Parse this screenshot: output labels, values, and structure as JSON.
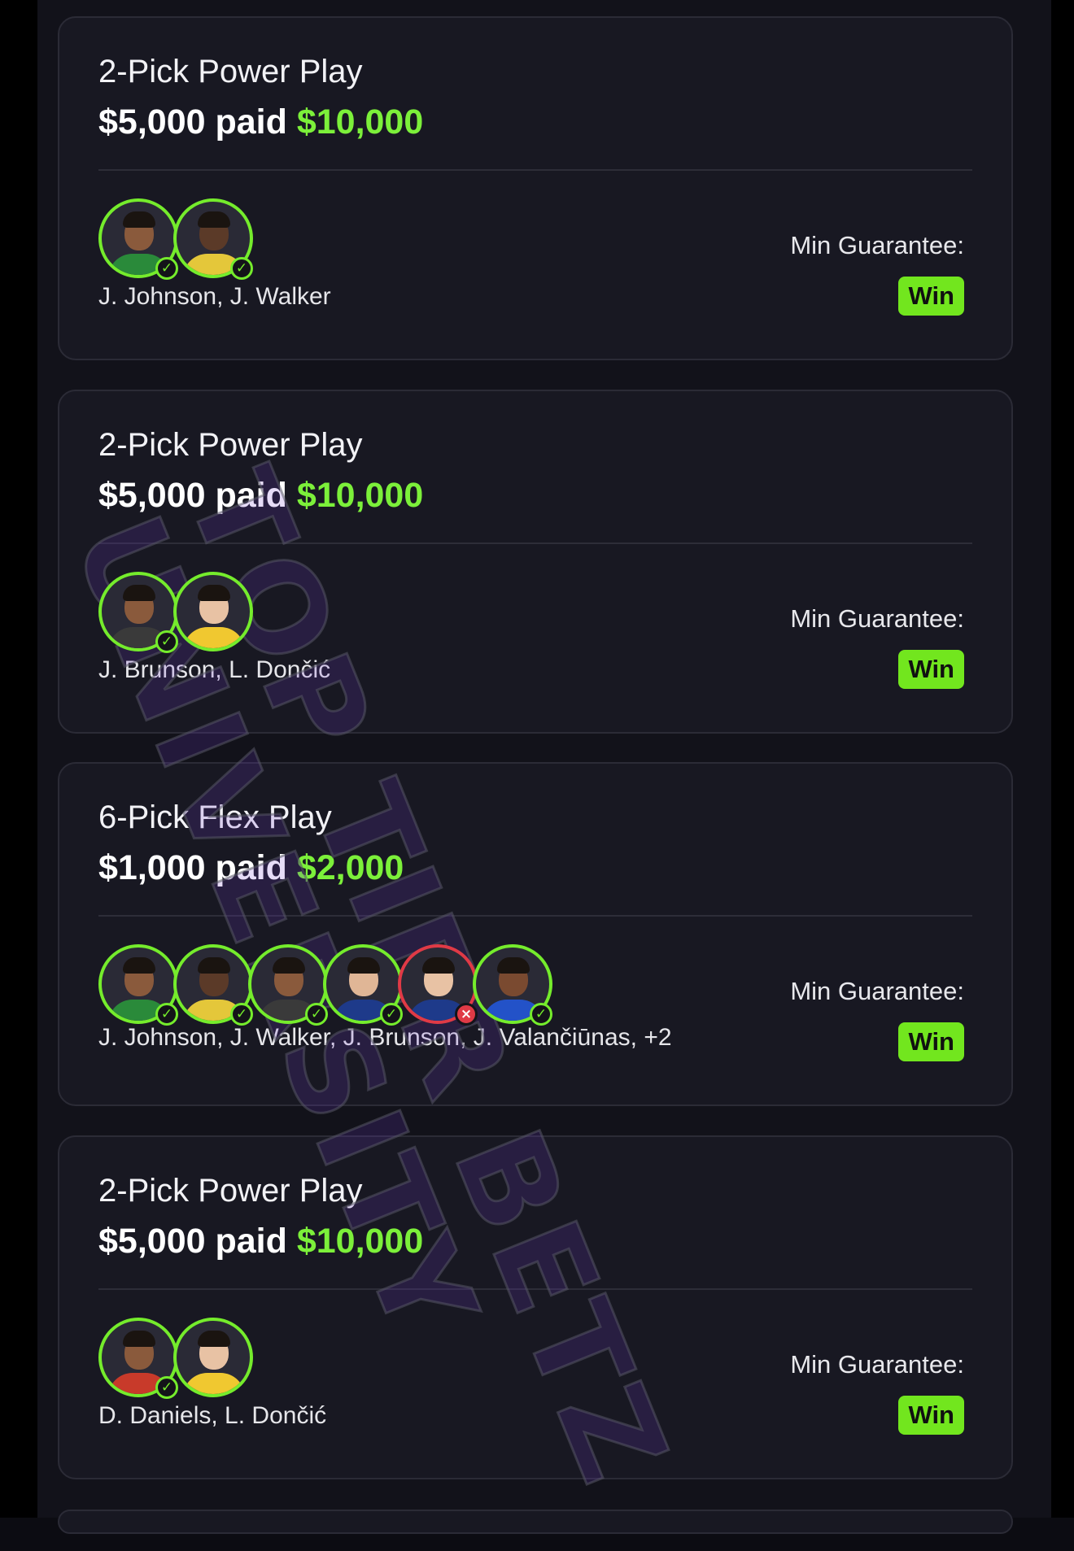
{
  "cards": [
    {
      "title": "2-Pick Power Play",
      "paid_text": "$5,000 paid",
      "won_text": "$10,000",
      "players_text": "J. Johnson, J. Walker",
      "guarantee_label": "Min Guarantee:",
      "result_label": "Win",
      "picks": [
        {
          "status": "won",
          "skin": "#8a5a3c",
          "shirt": "#2a8a3a"
        },
        {
          "status": "won",
          "skin": "#5b3a28",
          "shirt": "#e4c73a"
        }
      ]
    },
    {
      "title": "2-Pick Power Play",
      "paid_text": "$5,000 paid",
      "won_text": "$10,000",
      "players_text": "J. Brunson, L. Dončić",
      "guarantee_label": "Min Guarantee:",
      "result_label": "Win",
      "picks": [
        {
          "status": "won",
          "skin": "#8a5a3c",
          "shirt": "#3a3a3a"
        },
        {
          "status": "none",
          "skin": "#e8c2a4",
          "shirt": "#f0c830"
        }
      ]
    },
    {
      "title": "6-Pick Flex Play",
      "paid_text": "$1,000 paid",
      "won_text": "$2,000",
      "players_text": "J. Johnson, J. Walker, J. Brunson, J. Valančiūnas, +2",
      "guarantee_label": "Min Guarantee:",
      "result_label": "Win",
      "picks": [
        {
          "status": "won",
          "skin": "#8a5a3c",
          "shirt": "#2a8a3a"
        },
        {
          "status": "won",
          "skin": "#5b3a28",
          "shirt": "#e4c73a"
        },
        {
          "status": "won",
          "skin": "#8a5a3c",
          "shirt": "#3a3a3a"
        },
        {
          "status": "won",
          "skin": "#e0b696",
          "shirt": "#1e3a8a"
        },
        {
          "status": "lost",
          "skin": "#e8c2a4",
          "shirt": "#1e3a8a"
        },
        {
          "status": "won",
          "skin": "#7a4a30",
          "shirt": "#2352c8"
        }
      ]
    },
    {
      "title": "2-Pick Power Play",
      "paid_text": "$5,000 paid",
      "won_text": "$10,000",
      "players_text": "D. Daniels, L. Dončić",
      "guarantee_label": "Min Guarantee:",
      "result_label": "Win",
      "picks": [
        {
          "status": "won",
          "skin": "#8a5a3c",
          "shirt": "#c83a2a"
        },
        {
          "status": "none",
          "skin": "#e8c2a4",
          "shirt": "#f0c830"
        }
      ]
    }
  ],
  "watermark": {
    "line1": "TOP TIER BETZ",
    "line2": "UNIVERSITY"
  },
  "colors": {
    "accent_green": "#7cf03a",
    "badge_green": "#72e61e",
    "loss_red": "#e03a46",
    "card_bg": "#181822",
    "screen_bg": "#12121a"
  },
  "icons": {
    "check": "checkmark-icon",
    "cross": "x-icon"
  }
}
